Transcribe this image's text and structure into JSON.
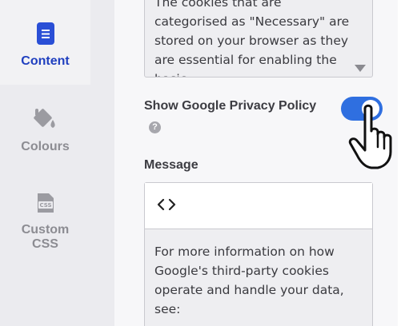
{
  "sidebar": {
    "items": [
      {
        "label": "Content",
        "icon": "document-icon",
        "active": true
      },
      {
        "label": "Colours",
        "icon": "paint-bucket-icon",
        "active": false
      },
      {
        "label": "Custom\nCSS",
        "icon": "css-file-icon",
        "active": false
      }
    ]
  },
  "main": {
    "top_textarea_text": "The cookies that are categorised as \"Necessary\" are stored on your browser as they are essential for enabling the basic",
    "toggle": {
      "label": "Show Google Privacy Policy",
      "help_icon_glyph": "?",
      "on": true
    },
    "message": {
      "label": "Message",
      "code_button_glyph": "<>",
      "body_text": "For more information on how Google's third-party cookies operate and handle your data, see:"
    }
  },
  "colors": {
    "accent": "#1f3fbf",
    "toggle_on": "#2f6fe0"
  }
}
